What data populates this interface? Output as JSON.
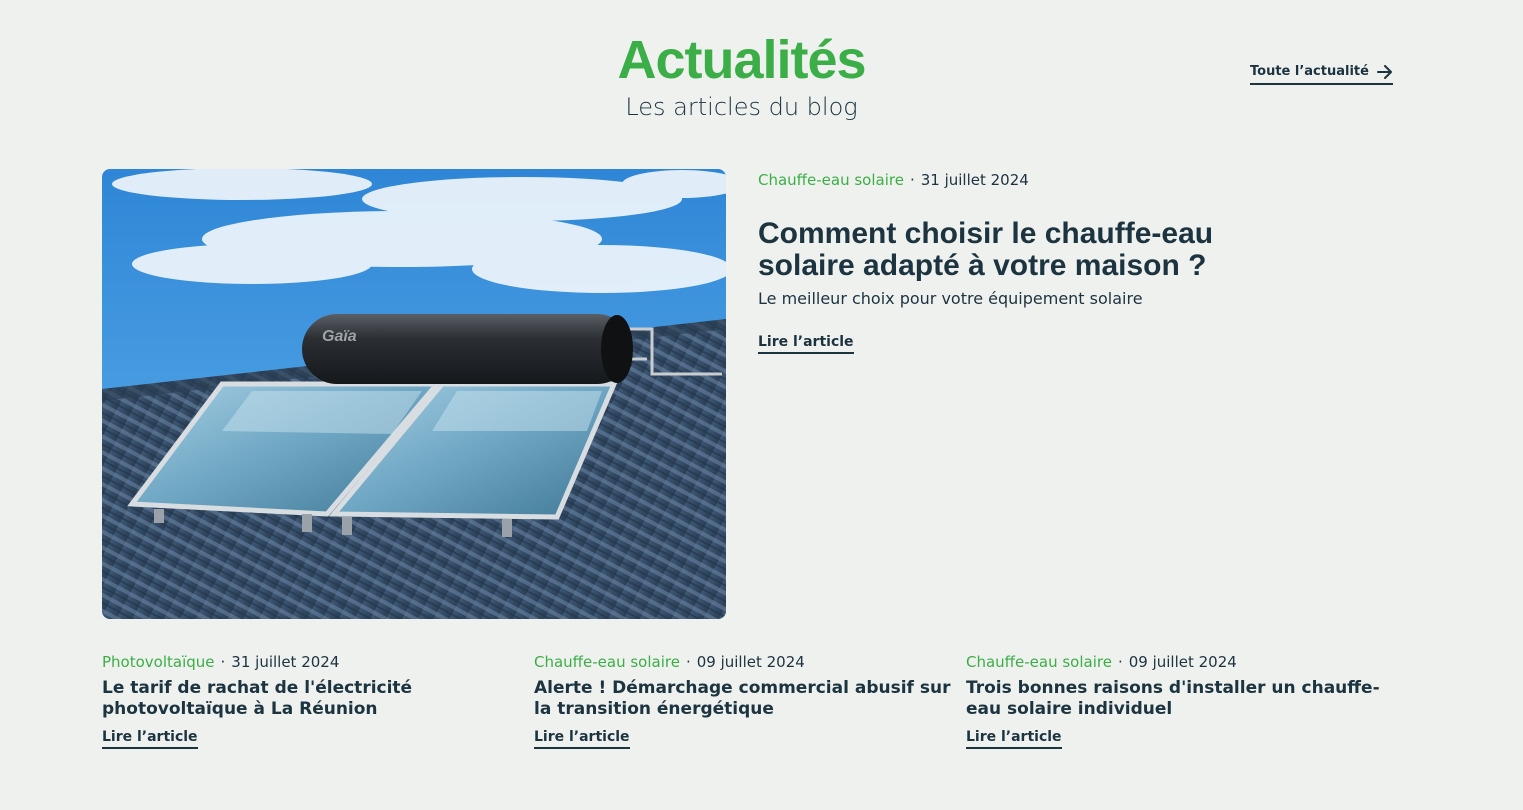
{
  "header": {
    "title": "Actualités",
    "subtitle": "Les articles du blog",
    "all_news_label": "Toute l’actualité"
  },
  "featured": {
    "category": "Chauffe-eau solaire",
    "separator": "·",
    "date": "31 juillet 2024",
    "title": "Comment choisir le chauffe-eau solaire adapté à votre maison ?",
    "subtitle": "Le meilleur choix pour votre équipement solaire",
    "read_label": "Lire l’article",
    "image_brand": "Gaïa"
  },
  "articles": [
    {
      "category": "Photovoltaïque",
      "separator": "·",
      "date": "31 juillet 2024",
      "title": "Le tarif de rachat de l'électricité photovoltaïque à La Réunion",
      "read_label": "Lire l’article"
    },
    {
      "category": "Chauffe-eau solaire",
      "separator": "·",
      "date": "09 juillet 2024",
      "title": "Alerte ! Démarchage commercial abusif sur la transition énergétique",
      "read_label": "Lire l’article"
    },
    {
      "category": "Chauffe-eau solaire",
      "separator": "·",
      "date": "09 juillet 2024",
      "title": "Trois bonnes raisons d'installer un chauffe-eau solaire individuel",
      "read_label": "Lire l’article"
    }
  ],
  "colors": {
    "accent": "#3cae47",
    "text": "#1c3340",
    "background": "#eff1ee"
  }
}
